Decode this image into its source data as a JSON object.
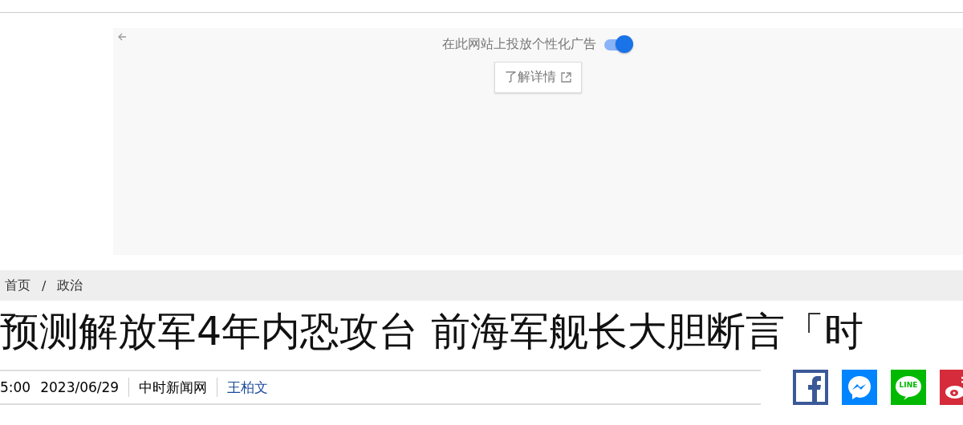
{
  "ad_panel": {
    "toggle": {
      "label": "在此网站上投放个性化广告",
      "on": true
    },
    "details_button": {
      "label": "了解详情"
    }
  },
  "breadcrumb": [
    "首页",
    "政治"
  ],
  "breadcrumb_separator": "/",
  "headline": "预测解放军4年内恐攻台 前海军舰长大胆断言「时",
  "meta": {
    "time": "5:00",
    "date": "2023/06/29",
    "source": "中时新闻网",
    "author": "王柏文"
  },
  "share": [
    {
      "kind": "facebook",
      "color": "#3b5998"
    },
    {
      "kind": "messenger",
      "color": "#0084ff"
    },
    {
      "kind": "line",
      "color": "#00b900",
      "text": "LINE"
    },
    {
      "kind": "weibo",
      "color": "#d52b3a"
    }
  ]
}
